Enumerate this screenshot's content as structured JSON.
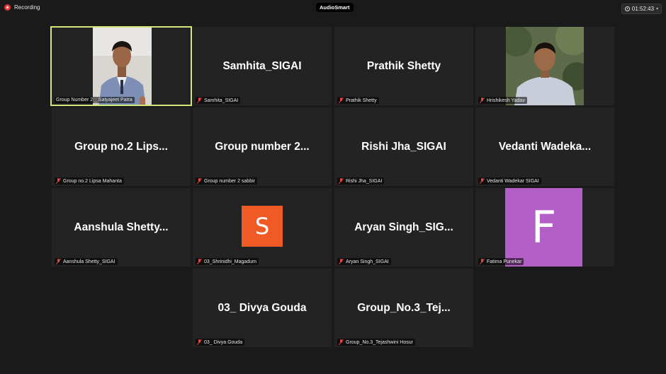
{
  "topbar": {
    "recording_label": "Recording",
    "app_name": "AudioSmart",
    "timer": "01:52:43"
  },
  "tiles": [
    {
      "name": "",
      "label": "Group Number 2 _ Satyajeet Patra",
      "video": true,
      "active": true
    },
    {
      "name": "Samhita_SIGAI",
      "label": "Samhita_SIGAI"
    },
    {
      "name": "Prathik Shetty",
      "label": "Prathik Shetty"
    },
    {
      "name": "",
      "label": "Hrishikesh Yadav",
      "video": true
    },
    {
      "name": "Group no.2 Lips...",
      "label": "Group no.2 Lipsa Mahanta"
    },
    {
      "name": "Group number 2...",
      "label": "Group number 2 sabbir"
    },
    {
      "name": "Rishi Jha_SIGAI",
      "label": "Rishi Jha_SIGAI"
    },
    {
      "name": "Vedanti Wadeka...",
      "label": "Vedanti Wadekar SIGAI"
    },
    {
      "name": "Aanshula Shetty...",
      "label": "Aanshula Shetty_SIGAI"
    },
    {
      "name": "",
      "label": "03_Shrinidhi_Magadum",
      "avatar_letter": "S",
      "avatar_color": "#f05a24"
    },
    {
      "name": "Aryan Singh_SIG...",
      "label": "Aryan Singh_SIGAI"
    },
    {
      "name": "",
      "label": "Fatima Punekar",
      "avatar_letter": "F",
      "avatar_color": "#b45ec8"
    },
    {
      "name": "03_ Divya Gouda",
      "label": "03_ Divya Gouda"
    },
    {
      "name": "Group_No.3_Tej...",
      "label": "Group_No.3_Tejashwini Hosur"
    }
  ],
  "colors": {
    "active_border": "#d2e77a",
    "tile_bg": "#232323",
    "page_bg": "#1a1a1a",
    "mic_off": "#e04646"
  }
}
